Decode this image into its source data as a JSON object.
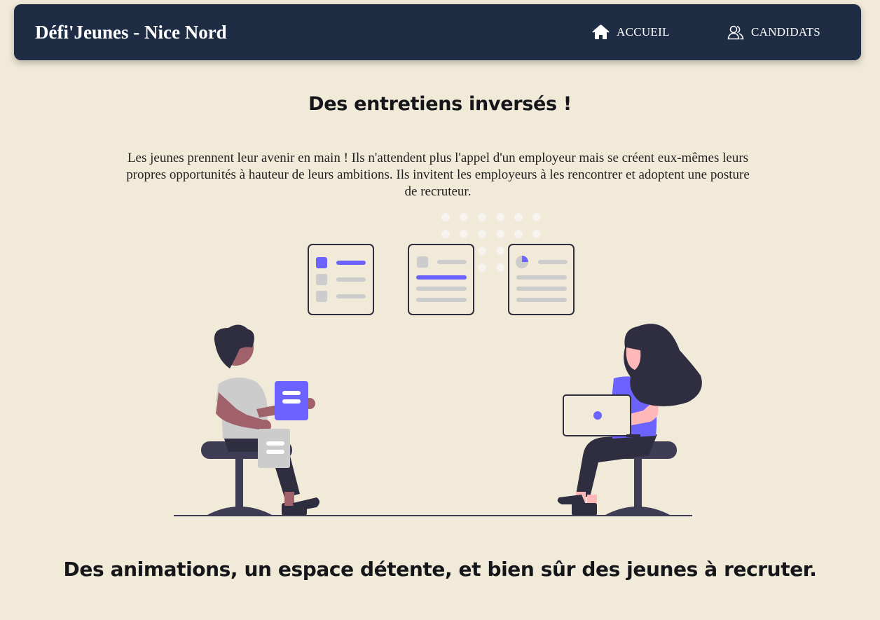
{
  "navbar": {
    "brand": "Défi'Jeunes - Nice Nord",
    "links": [
      {
        "label": "ACCUEIL",
        "icon": "home-icon"
      },
      {
        "label": "CANDIDATS",
        "icon": "users-icon"
      }
    ]
  },
  "main": {
    "title": "Des entretiens inversés !",
    "intro": "Les jeunes prennent leur avenir en main ! Ils n'attendent plus l'appel d'un employeur mais se créent eux-mêmes leurs propres opportunités à hauteur de leurs ambitions. Ils invitent les employeurs à les rencontrer et adoptent une posture de recruteur.",
    "subtitle": "Des animations, un espace détente, et bien sûr des jeunes à recruter."
  },
  "colors": {
    "background": "#f1ead9",
    "navbar": "#1e2d44",
    "accent": "#6c63ff",
    "dark": "#2f2e41"
  }
}
